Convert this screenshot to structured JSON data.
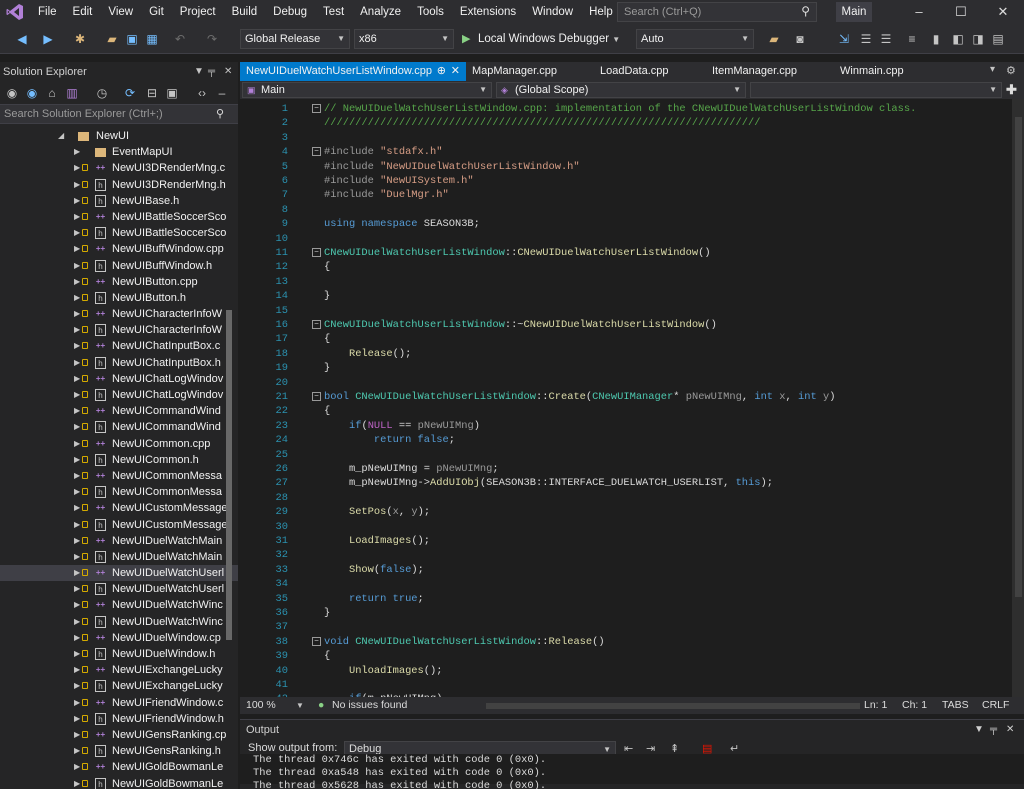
{
  "menubar": {
    "items": [
      "File",
      "Edit",
      "View",
      "Git",
      "Project",
      "Build",
      "Debug",
      "Test",
      "Analyze",
      "Tools",
      "Extensions",
      "Window",
      "Help"
    ],
    "search_placeholder": "Search (Ctrl+Q)",
    "solution_name": "Main"
  },
  "toolbar": {
    "configuration": "Global Release",
    "platform": "x86",
    "debugger": "Local Windows Debugger",
    "debugger_mode": "Auto"
  },
  "solution_explorer": {
    "title": "Solution Explorer",
    "search_placeholder": "Search Solution Explorer (Ctrl+;)",
    "project": "NewUI",
    "filter_folder": "EventMapUI",
    "files": [
      {
        "name": "NewUI3DRenderMng.c",
        "type": "cpp"
      },
      {
        "name": "NewUI3DRenderMng.h",
        "type": "h"
      },
      {
        "name": "NewUIBase.h",
        "type": "h"
      },
      {
        "name": "NewUIBattleSoccerSco",
        "type": "cpp"
      },
      {
        "name": "NewUIBattleSoccerSco",
        "type": "h"
      },
      {
        "name": "NewUIBuffWindow.cpp",
        "type": "cpp"
      },
      {
        "name": "NewUIBuffWindow.h",
        "type": "h"
      },
      {
        "name": "NewUIButton.cpp",
        "type": "cpp"
      },
      {
        "name": "NewUIButton.h",
        "type": "h"
      },
      {
        "name": "NewUICharacterInfoW",
        "type": "cpp"
      },
      {
        "name": "NewUICharacterInfoW",
        "type": "h"
      },
      {
        "name": "NewUIChatInputBox.c",
        "type": "cpp"
      },
      {
        "name": "NewUIChatInputBox.h",
        "type": "h"
      },
      {
        "name": "NewUIChatLogWindov",
        "type": "cpp"
      },
      {
        "name": "NewUIChatLogWindov",
        "type": "h"
      },
      {
        "name": "NewUICommandWind",
        "type": "cpp"
      },
      {
        "name": "NewUICommandWind",
        "type": "h"
      },
      {
        "name": "NewUICommon.cpp",
        "type": "cpp"
      },
      {
        "name": "NewUICommon.h",
        "type": "h"
      },
      {
        "name": "NewUICommonMessa",
        "type": "cpp"
      },
      {
        "name": "NewUICommonMessa",
        "type": "h"
      },
      {
        "name": "NewUICustomMessage",
        "type": "cpp"
      },
      {
        "name": "NewUICustomMessage",
        "type": "h"
      },
      {
        "name": "NewUIDuelWatchMain",
        "type": "cpp"
      },
      {
        "name": "NewUIDuelWatchMain",
        "type": "h"
      },
      {
        "name": "NewUIDuelWatchUserl",
        "type": "cpp",
        "selected": true
      },
      {
        "name": "NewUIDuelWatchUserl",
        "type": "h"
      },
      {
        "name": "NewUIDuelWatchWinc",
        "type": "cpp"
      },
      {
        "name": "NewUIDuelWatchWinc",
        "type": "h"
      },
      {
        "name": "NewUIDuelWindow.cp",
        "type": "cpp"
      },
      {
        "name": "NewUIDuelWindow.h",
        "type": "h"
      },
      {
        "name": "NewUIExchangeLucky",
        "type": "cpp"
      },
      {
        "name": "NewUIExchangeLucky",
        "type": "h"
      },
      {
        "name": "NewUIFriendWindow.c",
        "type": "cpp"
      },
      {
        "name": "NewUIFriendWindow.h",
        "type": "h"
      },
      {
        "name": "NewUIGensRanking.cp",
        "type": "cpp"
      },
      {
        "name": "NewUIGensRanking.h",
        "type": "h"
      },
      {
        "name": "NewUIGoldBowmanLe",
        "type": "cpp"
      },
      {
        "name": "NewUIGoldBowmanLe",
        "type": "h"
      }
    ]
  },
  "editor": {
    "tabs": [
      "NewUIDuelWatchUserListWindow.cpp",
      "MapManager.cpp",
      "LoadData.cpp",
      "ItemManager.cpp",
      "Winmain.cpp"
    ],
    "project_scope": "Main",
    "scope": "(Global Scope)",
    "lines": [
      {
        "n": "1",
        "fold": "minus",
        "seg": [
          [
            "cm",
            "// NewUIDuelWatchUserListWindow.cpp: implementation of the CNewUIDuelWatchUserListWindow class."
          ]
        ]
      },
      {
        "n": "2",
        "seg": [
          [
            "cm",
            "//////////////////////////////////////////////////////////////////////"
          ]
        ]
      },
      {
        "n": "3",
        "seg": []
      },
      {
        "n": "4",
        "fold": "minus",
        "seg": [
          [
            "pa",
            "#include "
          ],
          [
            "str",
            "\"stdafx.h\""
          ]
        ]
      },
      {
        "n": "5",
        "seg": [
          [
            "pa",
            "#include "
          ],
          [
            "str",
            "\"NewUIDuelWatchUserListWindow.h\""
          ]
        ]
      },
      {
        "n": "6",
        "seg": [
          [
            "pa",
            "#include "
          ],
          [
            "str",
            "\"NewUISystem.h\""
          ]
        ]
      },
      {
        "n": "7",
        "seg": [
          [
            "pa",
            "#include "
          ],
          [
            "str",
            "\"DuelMgr.h\""
          ]
        ]
      },
      {
        "n": "8",
        "seg": []
      },
      {
        "n": "9",
        "seg": [
          [
            "kw",
            "using namespace "
          ],
          [
            "tx",
            "SEASON3B;"
          ]
        ]
      },
      {
        "n": "10",
        "seg": []
      },
      {
        "n": "11",
        "fold": "minus",
        "seg": [
          [
            "ty",
            "CNewUIDuelWatchUserListWindow"
          ],
          [
            "tx",
            "::"
          ],
          [
            "fn",
            "CNewUIDuelWatchUserListWindow"
          ],
          [
            "tx",
            "()"
          ]
        ]
      },
      {
        "n": "12",
        "seg": [
          [
            "tx",
            "{"
          ]
        ]
      },
      {
        "n": "13",
        "seg": []
      },
      {
        "n": "14",
        "seg": [
          [
            "tx",
            "}"
          ]
        ]
      },
      {
        "n": "15",
        "seg": []
      },
      {
        "n": "16",
        "fold": "minus",
        "seg": [
          [
            "ty",
            "CNewUIDuelWatchUserListWindow"
          ],
          [
            "tx",
            "::~"
          ],
          [
            "fn",
            "CNewUIDuelWatchUserListWindow"
          ],
          [
            "tx",
            "()"
          ]
        ]
      },
      {
        "n": "17",
        "seg": [
          [
            "tx",
            "{"
          ]
        ]
      },
      {
        "n": "18",
        "seg": [
          [
            "tx",
            "    "
          ],
          [
            "fn",
            "Release"
          ],
          [
            "tx",
            "();"
          ]
        ]
      },
      {
        "n": "19",
        "seg": [
          [
            "tx",
            "}"
          ]
        ]
      },
      {
        "n": "20",
        "seg": []
      },
      {
        "n": "21",
        "fold": "minus",
        "seg": [
          [
            "kw",
            "bool "
          ],
          [
            "ty",
            "CNewUIDuelWatchUserListWindow"
          ],
          [
            "tx",
            "::"
          ],
          [
            "fn",
            "Create"
          ],
          [
            "tx",
            "("
          ],
          [
            "ty",
            "CNewUIManager"
          ],
          [
            "tx",
            "* "
          ],
          [
            "pa",
            "pNewUIMng"
          ],
          [
            "tx",
            ", "
          ],
          [
            "kw",
            "int "
          ],
          [
            "pa",
            "x"
          ],
          [
            "tx",
            ", "
          ],
          [
            "kw",
            "int "
          ],
          [
            "pa",
            "y"
          ],
          [
            "tx",
            ")"
          ]
        ]
      },
      {
        "n": "22",
        "seg": [
          [
            "tx",
            "{"
          ]
        ]
      },
      {
        "n": "23",
        "seg": [
          [
            "tx",
            "    "
          ],
          [
            "kw",
            "if"
          ],
          [
            "tx",
            "("
          ],
          [
            "mc",
            "NULL"
          ],
          [
            "tx",
            " == "
          ],
          [
            "pa",
            "pNewUIMng"
          ],
          [
            "tx",
            ")"
          ]
        ]
      },
      {
        "n": "24",
        "seg": [
          [
            "tx",
            "        "
          ],
          [
            "kw",
            "return false"
          ],
          [
            "tx",
            ";"
          ]
        ]
      },
      {
        "n": "25",
        "seg": []
      },
      {
        "n": "26",
        "seg": [
          [
            "tx",
            "    m_pNewUIMng = "
          ],
          [
            "pa",
            "pNewUIMng"
          ],
          [
            "tx",
            ";"
          ]
        ]
      },
      {
        "n": "27",
        "seg": [
          [
            "tx",
            "    m_pNewUIMng->"
          ],
          [
            "fn",
            "AddUIObj"
          ],
          [
            "tx",
            "(SEASON3B::INTERFACE_DUELWATCH_USERLIST, "
          ],
          [
            "kw",
            "this"
          ],
          [
            "tx",
            ");"
          ]
        ]
      },
      {
        "n": "28",
        "seg": []
      },
      {
        "n": "29",
        "seg": [
          [
            "tx",
            "    "
          ],
          [
            "fn",
            "SetPos"
          ],
          [
            "tx",
            "("
          ],
          [
            "pa",
            "x"
          ],
          [
            "tx",
            ", "
          ],
          [
            "pa",
            "y"
          ],
          [
            "tx",
            ");"
          ]
        ]
      },
      {
        "n": "30",
        "seg": []
      },
      {
        "n": "31",
        "seg": [
          [
            "tx",
            "    "
          ],
          [
            "fn",
            "LoadImages"
          ],
          [
            "tx",
            "();"
          ]
        ]
      },
      {
        "n": "32",
        "seg": []
      },
      {
        "n": "33",
        "seg": [
          [
            "tx",
            "    "
          ],
          [
            "fn",
            "Show"
          ],
          [
            "tx",
            "("
          ],
          [
            "kw",
            "false"
          ],
          [
            "tx",
            ");"
          ]
        ]
      },
      {
        "n": "34",
        "seg": []
      },
      {
        "n": "35",
        "seg": [
          [
            "tx",
            "    "
          ],
          [
            "kw",
            "return true"
          ],
          [
            "tx",
            ";"
          ]
        ]
      },
      {
        "n": "36",
        "seg": [
          [
            "tx",
            "}"
          ]
        ]
      },
      {
        "n": "37",
        "seg": []
      },
      {
        "n": "38",
        "fold": "minus",
        "seg": [
          [
            "kw",
            "void "
          ],
          [
            "ty",
            "CNewUIDuelWatchUserListWindow"
          ],
          [
            "tx",
            "::"
          ],
          [
            "fn",
            "Release"
          ],
          [
            "tx",
            "()"
          ]
        ]
      },
      {
        "n": "39",
        "seg": [
          [
            "tx",
            "{"
          ]
        ]
      },
      {
        "n": "40",
        "seg": [
          [
            "tx",
            "    "
          ],
          [
            "fn",
            "UnloadImages"
          ],
          [
            "tx",
            "();"
          ]
        ]
      },
      {
        "n": "41",
        "seg": []
      },
      {
        "n": "42",
        "seg": [
          [
            "tx",
            "    "
          ],
          [
            "kw",
            "if"
          ],
          [
            "tx",
            "(m_pNewUIMng)"
          ]
        ]
      }
    ]
  },
  "status_bar": {
    "zoom": "100 %",
    "issues": "No issues found",
    "line": "Ln: 1",
    "column": "Ch: 1",
    "indent": "TABS",
    "line_ending": "CRLF"
  },
  "output": {
    "title": "Output",
    "show_from_label": "Show output from:",
    "source": "Debug",
    "lines": [
      "The thread 0x746c has exited with code 0 (0x0).",
      "The thread 0xa548 has exited with code 0 (0x0).",
      "The thread 0x5628 has exited with code 0 (0x0)."
    ]
  },
  "colors": {
    "accent": "#007acc",
    "background": "#1e1e1e",
    "panel": "#252526",
    "chrome": "#2d2d30",
    "ok_icon": "#89d185"
  }
}
